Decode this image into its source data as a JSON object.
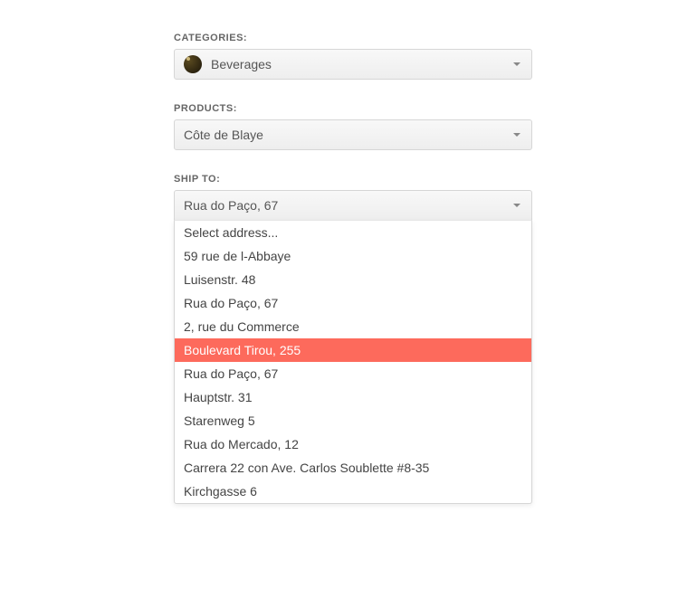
{
  "categories": {
    "label": "CATEGORIES:",
    "selected": "Beverages"
  },
  "products": {
    "label": "PRODUCTS:",
    "selected": "Côte de Blaye"
  },
  "ship_to": {
    "label": "SHIP TO:",
    "selected": "Rua do Paço, 67",
    "highlight_index": 5,
    "options": [
      "Select address...",
      "59 rue de l-Abbaye",
      "Luisenstr. 48",
      "Rua do Paço, 67",
      "2, rue du Commerce",
      "Boulevard Tirou, 255",
      "Rua do Paço, 67",
      "Hauptstr. 31",
      "Starenweg 5",
      "Rua do Mercado, 12",
      "Carrera 22 con Ave. Carlos Soublette #8-35",
      "Kirchgasse 6"
    ]
  }
}
